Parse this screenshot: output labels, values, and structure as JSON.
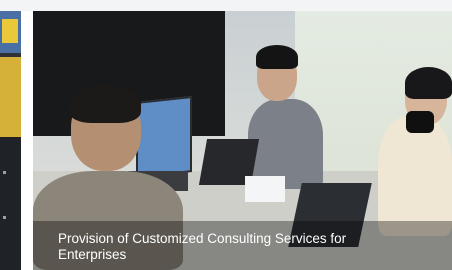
{
  "carousel": {
    "current_slide": {
      "caption": "Provision of Customized Consulting Services for Enterprises"
    }
  }
}
